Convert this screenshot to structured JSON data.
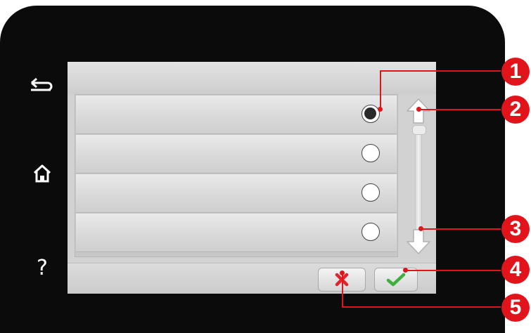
{
  "side_buttons": {
    "back_icon": "back-arrow-icon",
    "home_icon": "home-icon",
    "help_glyph": "?"
  },
  "options": [
    {
      "label": "",
      "selected": true
    },
    {
      "label": "",
      "selected": false
    },
    {
      "label": "",
      "selected": false
    },
    {
      "label": "",
      "selected": false
    }
  ],
  "scrollbar": {
    "up_icon": "up-arrow-icon",
    "down_icon": "down-arrow-icon"
  },
  "actions": {
    "cancel_icon": "cancel-x-icon",
    "confirm_icon": "confirm-check-icon"
  },
  "callouts": [
    "1",
    "2",
    "3",
    "4",
    "5"
  ],
  "colors": {
    "callout": "#e1141b",
    "cancel": "#e0242b",
    "confirm": "#3fae3f",
    "bezel": "#0b0b0b"
  }
}
